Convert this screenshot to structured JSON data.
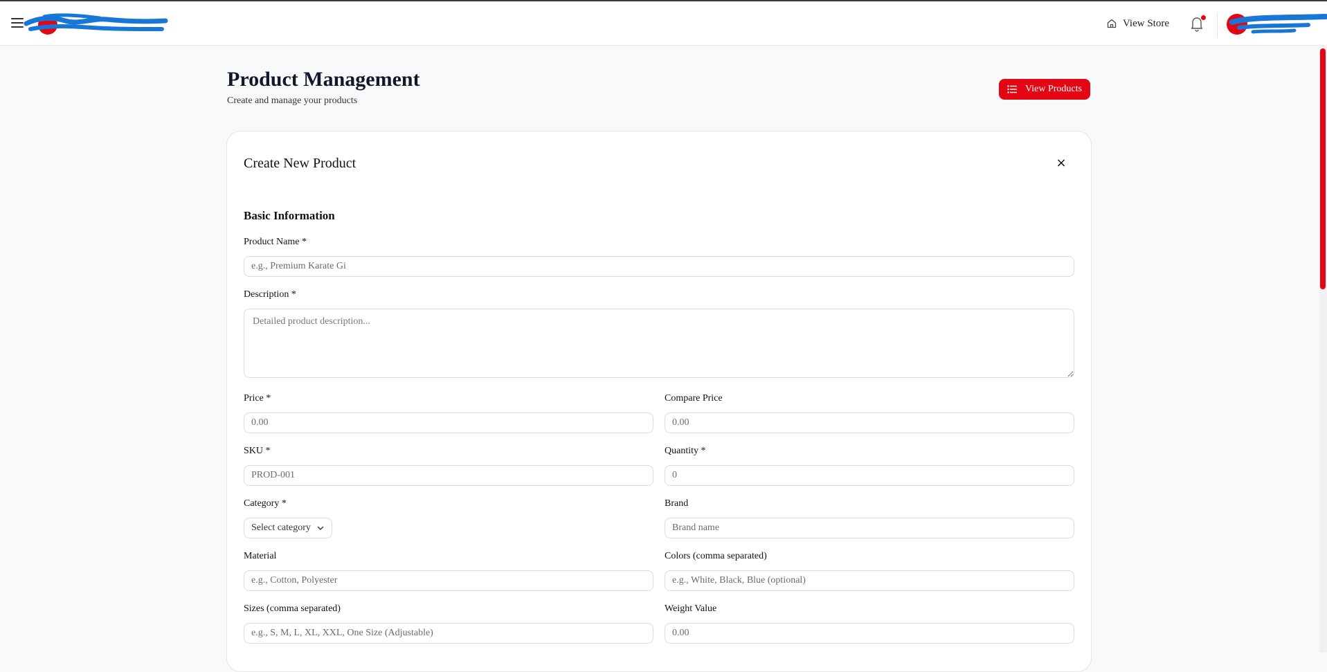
{
  "header": {
    "view_store": "View Store"
  },
  "page": {
    "title": "Product Management",
    "subtitle": "Create and manage your products",
    "view_products": "View Products"
  },
  "form": {
    "title": "Create New Product",
    "close": "×",
    "section": "Basic Information",
    "product_name": {
      "label": "Product Name *",
      "placeholder": "e.g., Premium Karate Gi"
    },
    "description": {
      "label": "Description *",
      "placeholder": "Detailed product description..."
    },
    "price": {
      "label": "Price *",
      "placeholder": "0.00"
    },
    "compare_price": {
      "label": "Compare Price",
      "placeholder": "0.00"
    },
    "sku": {
      "label": "SKU *",
      "placeholder": "PROD-001"
    },
    "quantity": {
      "label": "Quantity *",
      "placeholder": "0"
    },
    "category": {
      "label": "Category *",
      "selected": "Select category"
    },
    "brand": {
      "label": "Brand",
      "placeholder": "Brand name"
    },
    "material": {
      "label": "Material",
      "placeholder": "e.g., Cotton, Polyester"
    },
    "colors": {
      "label": "Colors (comma separated)",
      "placeholder": "e.g., White, Black, Blue (optional)"
    },
    "sizes": {
      "label": "Sizes (comma separated)",
      "placeholder": "e.g., S, M, L, XL, XXL, One Size (Adjustable)"
    },
    "weight": {
      "label": "Weight Value",
      "placeholder": "0.00"
    }
  },
  "colors": {
    "accent": "#e30613",
    "redaction": "#1877d6"
  },
  "icons": [
    "menu-icon",
    "home-icon",
    "bell-icon",
    "list-icon",
    "chevron-down-icon",
    "close-icon"
  ]
}
